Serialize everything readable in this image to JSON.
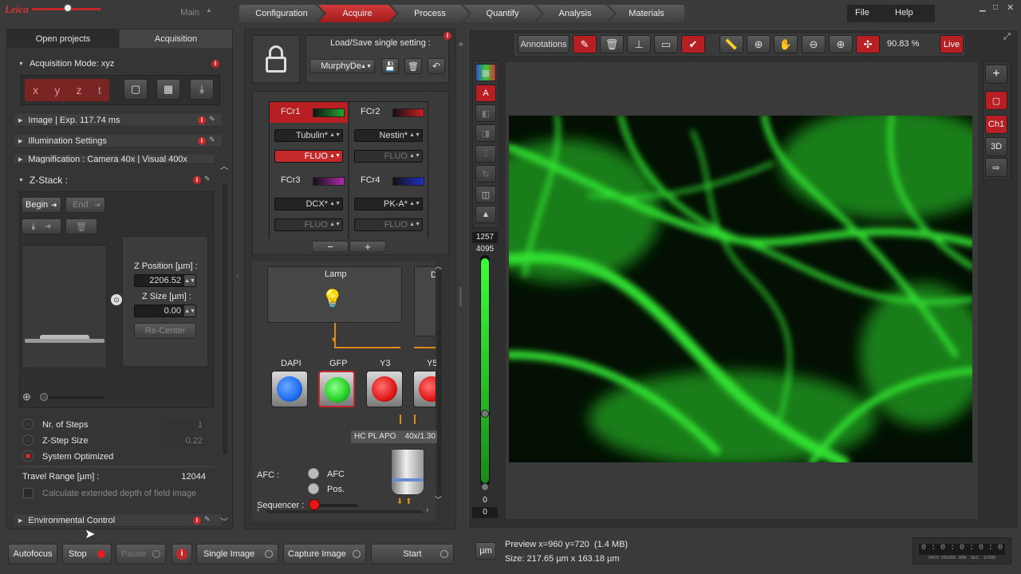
{
  "topbar": {
    "logo": "Leica",
    "workspace": "Main",
    "menu_file": "File",
    "menu_help": "Help"
  },
  "workflow": [
    "Configuration",
    "Acquire",
    "Process",
    "Quantify",
    "Analysis",
    "Materials"
  ],
  "left": {
    "tabs": [
      "Open projects",
      "Acquisition"
    ],
    "acq_mode": "Acquisition Mode: xyz",
    "axes": [
      "x",
      "y",
      "z",
      "t"
    ],
    "sections": {
      "image": "Image | Exp. 117.74 ms",
      "illumination": "Illumination Settings",
      "magnification": "Magnification : Camera 40x | Visual 400x",
      "zstack": "Z-Stack :",
      "env": "Environmental Control"
    },
    "begin": "Begin",
    "end": "End",
    "zpos_label": "Z Position [µm] :",
    "zpos_value": "2206.52",
    "zsize_label": "Z Size [µm] :",
    "zsize_value": "0.00",
    "recenter": "Re-Center",
    "options": [
      {
        "label": "Nr. of Steps",
        "value": "1",
        "selected": false
      },
      {
        "label": "Z-Step Size",
        "value": "0.22",
        "selected": false
      },
      {
        "label": "System Optimized",
        "value": "",
        "selected": true
      }
    ],
    "travel_label": "Travel Range [µm] :",
    "travel_value": "12044",
    "edof_label": "Calculate extended depth of field image"
  },
  "middle": {
    "loadsave": "Load/Save single setting :",
    "setting": "MurphyDe",
    "channels": [
      {
        "name": "FCr1",
        "marker": "Tubulin*",
        "mode": "FLUO",
        "color": "#1fa82c",
        "active": true
      },
      {
        "name": "FCr2",
        "marker": "Nestin*",
        "mode": "FLUO",
        "color": "#c82020",
        "active": false
      },
      {
        "name": "FCr3",
        "marker": "DCX*",
        "mode": "FLUO",
        "color": "#b02ab0",
        "active": false
      },
      {
        "name": "FCr4",
        "marker": "PK-A*",
        "mode": "FLUO",
        "color": "#2030c8",
        "active": false
      }
    ],
    "lamp": "Lamp",
    "lamp2": "D",
    "cubes": [
      {
        "name": "DAPI",
        "color": "#1e6cf0"
      },
      {
        "name": "GFP",
        "color": "#25d025"
      },
      {
        "name": "Y3",
        "color": "#e01818"
      },
      {
        "name": "Y5",
        "color": "#e01818"
      }
    ],
    "objective": "HC PL APO    40x/1.30",
    "afc_label": "AFC :",
    "afc_opt1": "AFC",
    "afc_opt2": "Pos.",
    "sequencer": "Sequencer :"
  },
  "viewer": {
    "annotations": "Annotations",
    "zoom": "90.83 %",
    "live": "Live",
    "hist_top": "1257",
    "hist_max": "4095",
    "hist_min": "0",
    "hist_bottom": "0",
    "right_labels": [
      "Ch1",
      "3D"
    ],
    "unit": "µm",
    "preview": "Preview x=960 y=720  (1.4 MB)",
    "size": "Size: 217.65 µm x 163.18 µm",
    "timer": "0 : 0 : 0 : 0 : 0",
    "timer_units": "DAYS  HOURS   MIN    SEC    1/1000"
  },
  "bottom": {
    "autofocus": "Autofocus",
    "stop": "Stop",
    "pause": "Pause",
    "single": "Single Image",
    "capture": "Capture Image",
    "start": "Start"
  },
  "colors": {
    "accent": "#c3282b",
    "bg": "#3a3a3a",
    "green": "#2ad02a"
  }
}
